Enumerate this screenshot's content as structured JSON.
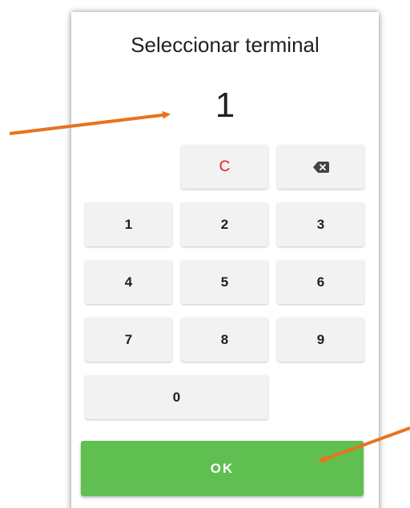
{
  "dialog": {
    "title": "Seleccionar terminal",
    "display_value": "1"
  },
  "keypad": {
    "clear_label": "C",
    "backspace_icon": "backspace-icon",
    "keys": [
      "1",
      "2",
      "3",
      "4",
      "5",
      "6",
      "7",
      "8",
      "9",
      "0"
    ]
  },
  "actions": {
    "ok_label": "OK"
  },
  "colors": {
    "ok_green": "#5fbf50",
    "clear_red": "#e02020",
    "annotation_arrow": "#e8731d"
  }
}
